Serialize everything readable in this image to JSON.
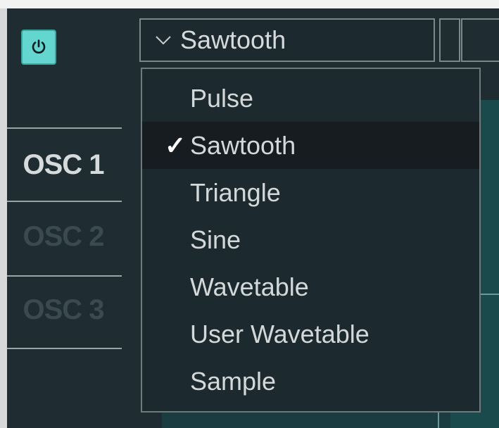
{
  "toolbar": {
    "power_icon": "power-icon",
    "power_on": true
  },
  "osc_tabs": [
    {
      "label": "OSC 1",
      "active": true
    },
    {
      "label": "OSC 2",
      "active": false
    },
    {
      "label": "OSC 3",
      "active": false
    }
  ],
  "waveform_select": {
    "icon": "chevron-down-icon",
    "value": "Sawtooth"
  },
  "dropdown": {
    "items": [
      {
        "label": "Pulse",
        "selected": false
      },
      {
        "label": "Sawtooth",
        "selected": true
      },
      {
        "label": "Triangle",
        "selected": false
      },
      {
        "label": "Sine",
        "selected": false
      },
      {
        "label": "Wavetable",
        "selected": false
      },
      {
        "label": "User Wavetable",
        "selected": false
      },
      {
        "label": "Sample",
        "selected": false
      }
    ],
    "check_glyph": "✓"
  },
  "colors": {
    "accent": "#62d6cf",
    "panel_bg": "#1f2c31",
    "text": "#d6dadb"
  }
}
